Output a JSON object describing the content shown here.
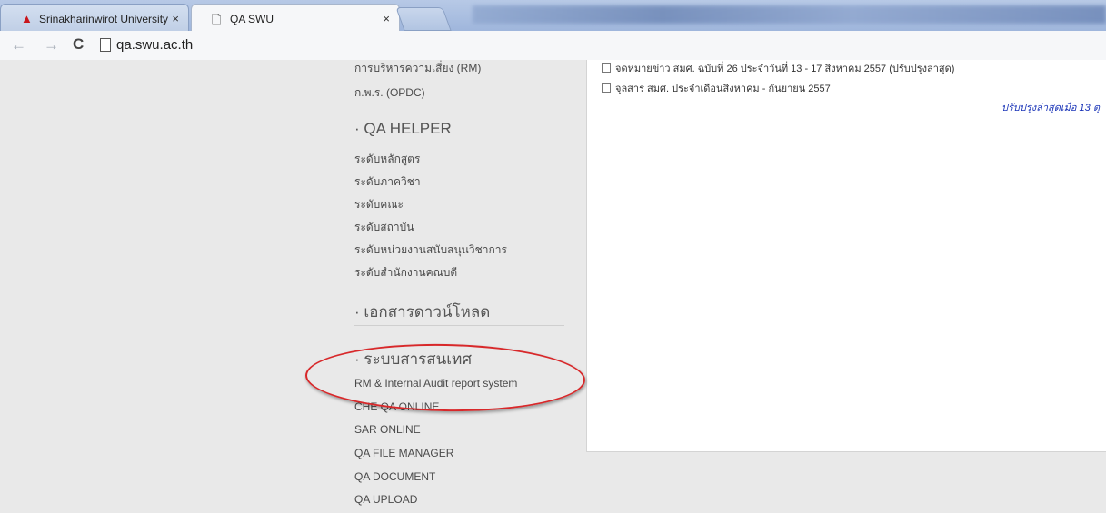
{
  "browser": {
    "tabs": [
      {
        "label": "Srinakharinwirot University",
        "icon": "swu-logo-icon"
      },
      {
        "label": "QA SWU",
        "icon": "page-icon"
      }
    ],
    "close_glyph": "×",
    "address": "qa.swu.ac.th"
  },
  "sidebar": {
    "top_links": [
      "การบริหารความเสี่ยง (RM)",
      "ก.พ.ร. (OPDC)"
    ],
    "sections": [
      {
        "title": "QA HELPER",
        "items": [
          "ระดับหลักสูตร",
          "ระดับภาควิชา",
          "ระดับคณะ",
          "ระดับสถาบัน",
          "ระดับหน่วยงานสนับสนุนวิชาการ",
          "ระดับสำนักงานคณบดี"
        ]
      },
      {
        "title": "เอกสารดาวน์โหลด",
        "items": []
      },
      {
        "title": "ระบบสารสนเทศ",
        "items": [
          "RM & Internal Audit report system",
          "CHE QA ONLINE",
          "SAR ONLINE",
          "QA FILE MANAGER",
          "QA DOCUMENT",
          "QA UPLOAD"
        ]
      }
    ]
  },
  "content": {
    "news": [
      "จดหมายข่าว สมศ. ฉบับที่ 26 ประจำวันที่ 13 - 17 สิงหาคม 2557 (ปรับปรุงล่าสุด)",
      "จุลสาร สมศ. ประจำเดือนสิงหาคม - กันยายน 2557"
    ],
    "updated": "ปรับปรุงล่าสุดเมื่อ 13 ตุ"
  },
  "colors": {
    "annotation": "#d8282a",
    "link_blue": "#1b35b8"
  }
}
